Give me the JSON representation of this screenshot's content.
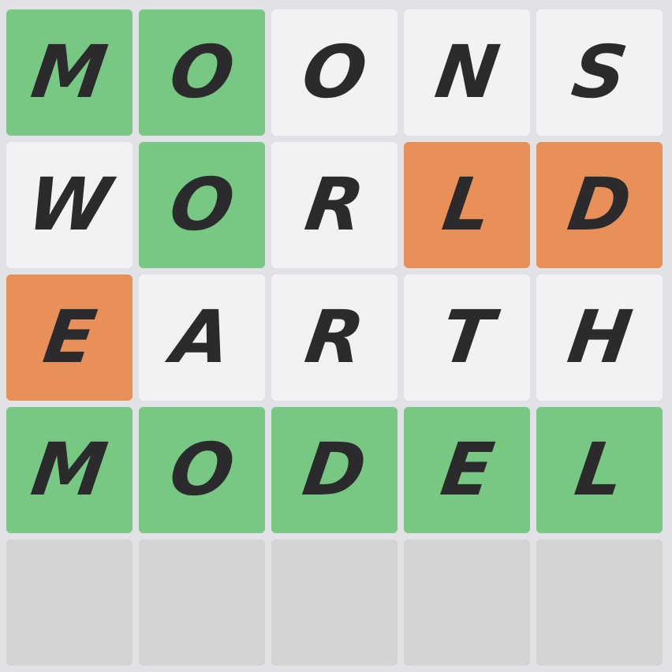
{
  "colors": {
    "correct": "#77c882",
    "present": "#e98f58",
    "absent": "#f1f2f3",
    "empty": "#d4d4d5",
    "letter": "#2b2b2d"
  },
  "rows": [
    [
      {
        "letter": "M",
        "state": "correct"
      },
      {
        "letter": "O",
        "state": "correct"
      },
      {
        "letter": "O",
        "state": "absent"
      },
      {
        "letter": "N",
        "state": "absent"
      },
      {
        "letter": "S",
        "state": "absent"
      }
    ],
    [
      {
        "letter": "W",
        "state": "absent"
      },
      {
        "letter": "O",
        "state": "correct"
      },
      {
        "letter": "R",
        "state": "absent"
      },
      {
        "letter": "L",
        "state": "present"
      },
      {
        "letter": "D",
        "state": "present"
      }
    ],
    [
      {
        "letter": "E",
        "state": "present"
      },
      {
        "letter": "A",
        "state": "absent"
      },
      {
        "letter": "R",
        "state": "absent"
      },
      {
        "letter": "T",
        "state": "absent"
      },
      {
        "letter": "H",
        "state": "absent"
      }
    ],
    [
      {
        "letter": "M",
        "state": "correct"
      },
      {
        "letter": "O",
        "state": "correct"
      },
      {
        "letter": "D",
        "state": "correct"
      },
      {
        "letter": "E",
        "state": "correct"
      },
      {
        "letter": "L",
        "state": "correct"
      }
    ],
    [
      {
        "letter": "",
        "state": "empty"
      },
      {
        "letter": "",
        "state": "empty"
      },
      {
        "letter": "",
        "state": "empty"
      },
      {
        "letter": "",
        "state": "empty"
      },
      {
        "letter": "",
        "state": "empty"
      }
    ]
  ]
}
